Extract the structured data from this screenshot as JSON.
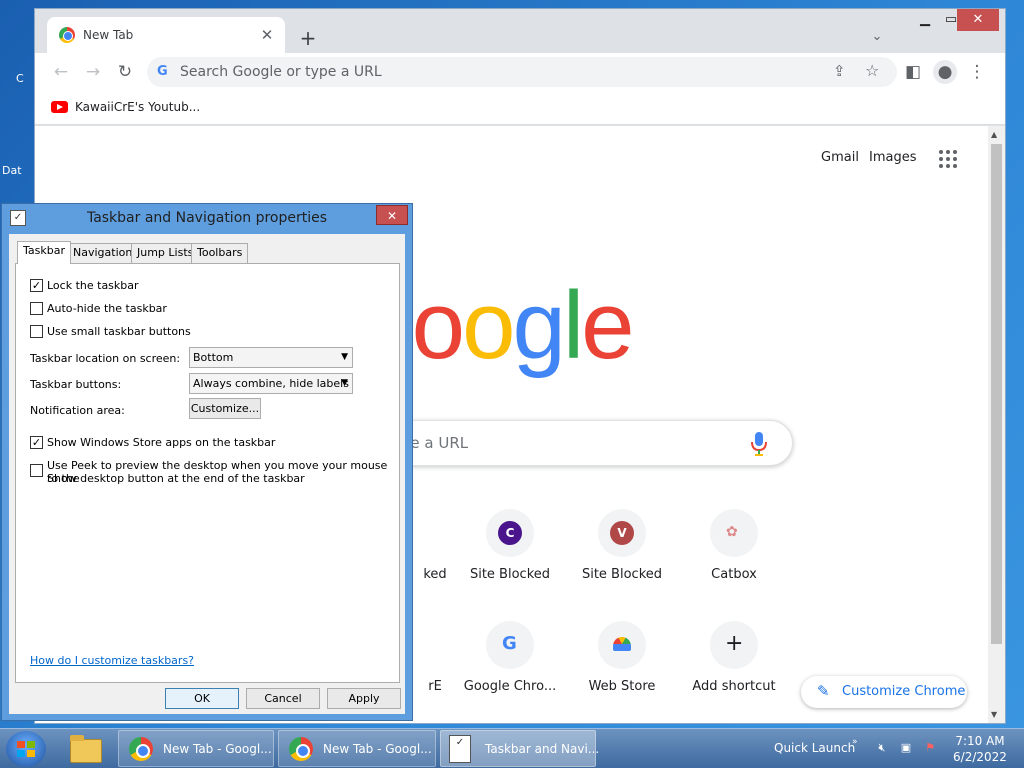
{
  "desktop": {
    "fragment_1": "C",
    "fragment_2": "Dat"
  },
  "browser": {
    "tab_title": "New Tab",
    "tab_close": "✕",
    "new_tab": "+",
    "omnibox_placeholder": "Search Google or type a URL",
    "bookmark_label": "KawaiiCrE's Youtub...",
    "top_links": {
      "gmail": "Gmail",
      "images": "Images"
    },
    "search_text": "ype a URL",
    "shortcuts": [
      {
        "label": "ked",
        "letter": ""
      },
      {
        "label": "Site Blocked",
        "letter": "C",
        "color": "#4a148c"
      },
      {
        "label": "Site Blocked",
        "letter": "V",
        "color": "#b04848"
      },
      {
        "label": "Catbox",
        "letter": ""
      },
      {
        "label": "rE",
        "letter": ""
      },
      {
        "label": "Google Chro...",
        "letter": "G"
      },
      {
        "label": "Web Store",
        "letter": ""
      },
      {
        "label": "Add shortcut",
        "letter": "+"
      }
    ],
    "customize_label": "Customize Chrome"
  },
  "dialog": {
    "title": "Taskbar and Navigation properties",
    "tabs": [
      "Taskbar",
      "Navigation",
      "Jump Lists",
      "Toolbars"
    ],
    "checkboxes": [
      {
        "label": "Lock the taskbar",
        "checked": true
      },
      {
        "label": "Auto-hide the taskbar",
        "checked": false
      },
      {
        "label": "Use small taskbar buttons",
        "checked": false
      },
      {
        "label": "Show Windows Store apps on the taskbar",
        "checked": true
      },
      {
        "label": "Use Peek to preview the desktop when you move your mouse to the",
        "label2": "Show desktop button at the end of the taskbar",
        "checked": false
      }
    ],
    "location_label": "Taskbar location on screen:",
    "location_value": "Bottom",
    "buttons_label": "Taskbar buttons:",
    "buttons_value": "Always combine, hide labels",
    "notification_label": "Notification area:",
    "customize_button": "Customize...",
    "help_link": "How do I customize taskbars?",
    "ok": "OK",
    "cancel": "Cancel",
    "apply": "Apply"
  },
  "taskbar": {
    "items": [
      "New Tab - Googl...",
      "New Tab - Googl...",
      "Taskbar and Navi..."
    ],
    "quick_launch": "Quick Launch",
    "time": "7:10 AM",
    "date": "6/2/2022"
  },
  "colors": {
    "accent": "#1a73e8",
    "google_blue": "#4285f4",
    "google_red": "#ea4335",
    "google_yellow": "#fbbc05",
    "google_green": "#34a853"
  }
}
